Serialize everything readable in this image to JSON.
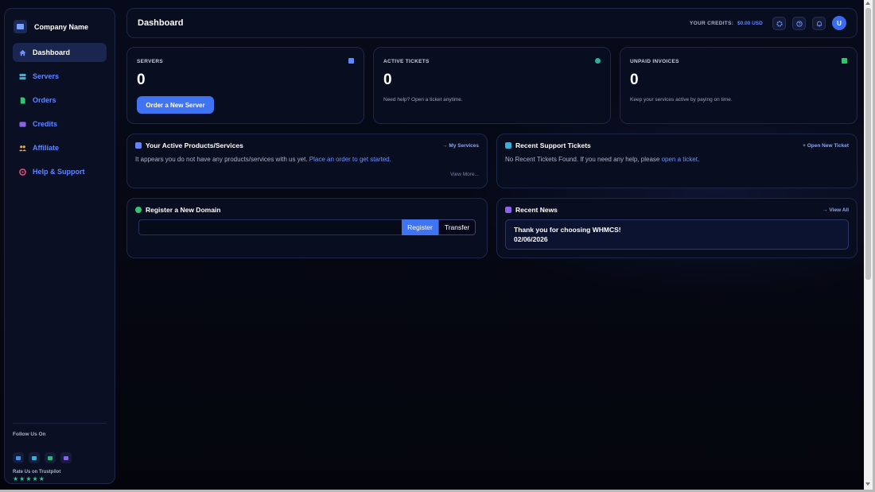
{
  "brand": {
    "name": "Company Name"
  },
  "sidebar": {
    "items": [
      {
        "label": "Dashboard",
        "icon": "home-icon",
        "color": "#6f93ff",
        "active": true
      },
      {
        "label": "Servers",
        "icon": "server-icon",
        "color": "#3ab0d8"
      },
      {
        "label": "Orders",
        "icon": "document-icon",
        "color": "#34c46f"
      },
      {
        "label": "Credits",
        "icon": "credit-card-icon",
        "color": "#8a63e6"
      },
      {
        "label": "Affiliate",
        "icon": "users-icon",
        "color": "#f0a432"
      },
      {
        "label": "Help & Support",
        "icon": "lifebuoy-icon",
        "color": "#e0487c"
      }
    ],
    "follow_label": "Follow Us On",
    "socials": [
      {
        "icon": "twitter-icon",
        "color": "#4a90e2"
      },
      {
        "icon": "discord-icon",
        "color": "#3ab0d8"
      },
      {
        "icon": "instagram-icon",
        "color": "#2fb87a"
      },
      {
        "icon": "twitch-icon",
        "color": "#8a63e6"
      }
    ],
    "rate_label": "Rate Us on Trustpilot",
    "stars": "★★★★★"
  },
  "header": {
    "title": "Dashboard",
    "credits_label": "YOUR CREDITS:",
    "credits_value": "$0.00 USD",
    "avatar_initial": "U"
  },
  "stats": {
    "servers": {
      "label": "SERVERS",
      "value": "0",
      "button": "Order a New Server"
    },
    "tickets": {
      "label": "ACTIVE TICKETS",
      "value": "0",
      "note": "Need help? Open a ticket anytime."
    },
    "invoices": {
      "label": "UNPAID INVOICES",
      "value": "0",
      "note": "Keep your services active by paying on time."
    }
  },
  "products": {
    "title": "Your Active Products/Services",
    "link": "→ My Services",
    "text": "It appears you do not have any products/services with us yet. ",
    "text_link": "Place an order to get started",
    "text_end": ".",
    "view_more": "View More..."
  },
  "support": {
    "title": "Recent Support Tickets",
    "link": "+ Open New Ticket",
    "text": "No Recent Tickets Found. If you need any help, please ",
    "text_link": "open a ticket",
    "text_end": "."
  },
  "domain": {
    "title": "Register a New Domain",
    "register": "Register",
    "transfer": "Transfer"
  },
  "news": {
    "title": "Recent News",
    "link": "→ View All",
    "item_title": "Thank you for choosing WHMCS!",
    "item_date": "02/06/2026"
  }
}
